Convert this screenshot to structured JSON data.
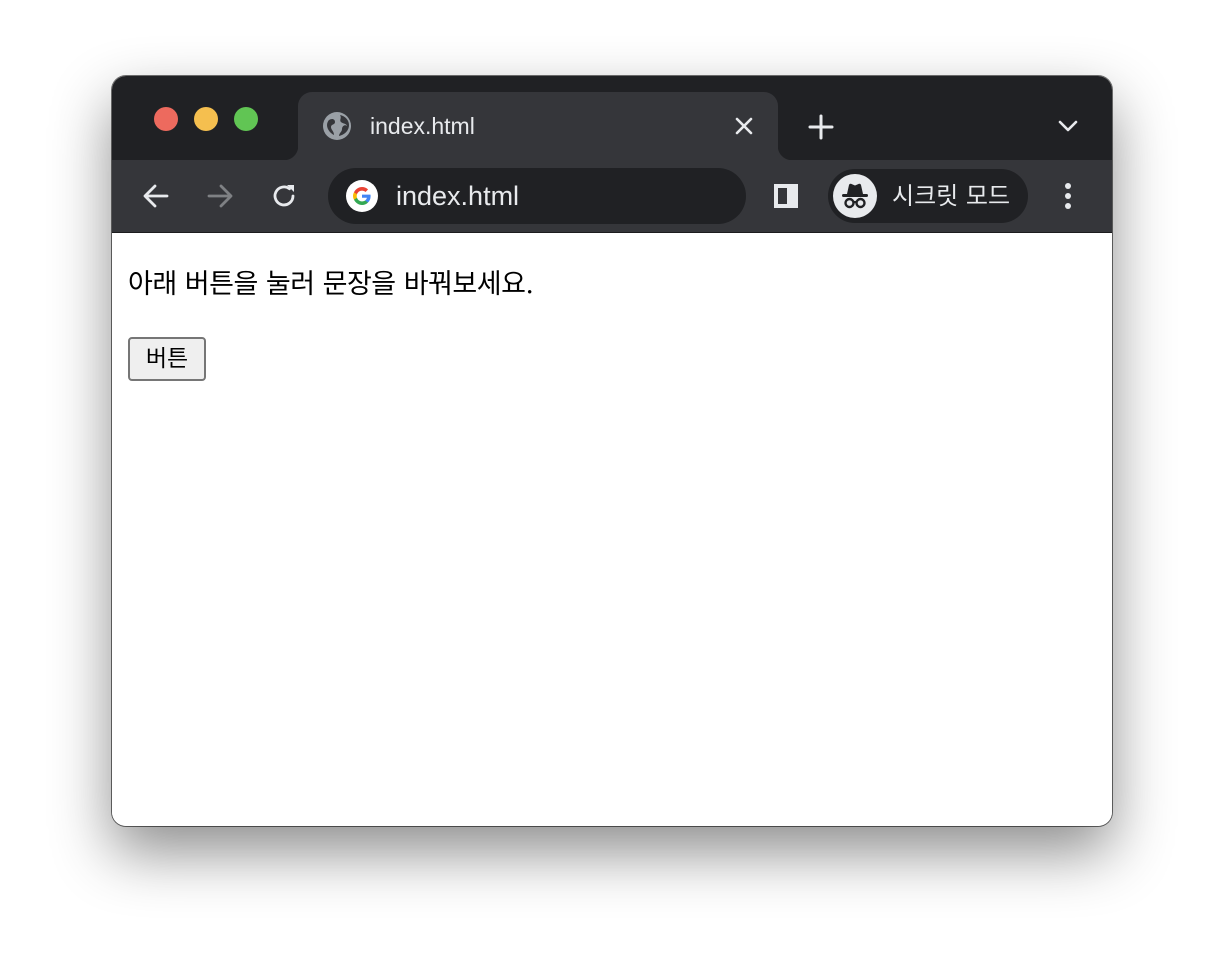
{
  "browser": {
    "tab": {
      "title": "index.html",
      "favicon": "globe-icon"
    },
    "toolbar": {
      "back_icon": "arrow-left-icon",
      "forward_icon": "arrow-right-icon",
      "reload_icon": "reload-icon",
      "address": "index.html",
      "address_icon": "google-g-icon",
      "side_panel_icon": "side-panel-icon",
      "incognito_label": "시크릿 모드",
      "incognito_icon": "incognito-icon",
      "menu_icon": "kebab-menu-icon"
    },
    "colors": {
      "tabstrip": "#202124",
      "toolbar": "#35363a",
      "traffic_red": "#ed6a5e",
      "traffic_yellow": "#f5bf4f",
      "traffic_green": "#61c554"
    }
  },
  "page": {
    "text": "아래 버튼을 눌러 문장을 바꿔보세요.",
    "button_label": "버튼"
  }
}
